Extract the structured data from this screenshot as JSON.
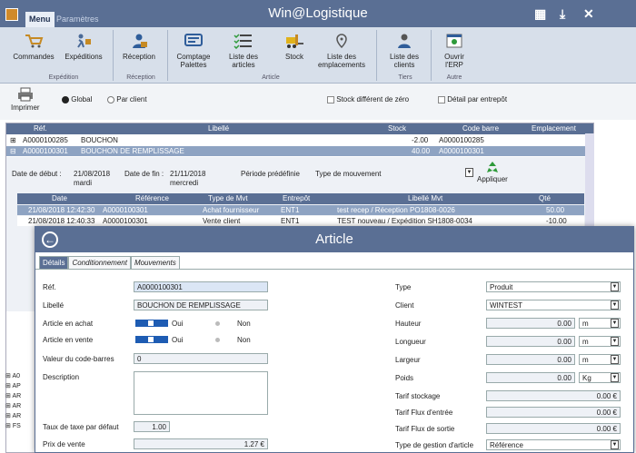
{
  "titlebar": {
    "title": "Win@Logistique",
    "menu_tab": "Menu",
    "param_tab": "Paramètres"
  },
  "ribbon": {
    "commandes": "Commandes",
    "expeditions": "Expéditions",
    "reception": "Réception",
    "comptage_l1": "Comptage",
    "comptage_l2": "Palettes",
    "liste_articles_l1": "Liste des",
    "liste_articles_l2": "articles",
    "stock": "Stock",
    "liste_emplacements_l1": "Liste des",
    "liste_emplacements_l2": "emplacements",
    "liste_clients_l1": "Liste des",
    "liste_clients_l2": "clients",
    "ouvrir_l1": "Ouvrir",
    "ouvrir_l2": "l'ERP",
    "group_expedition": "Expédition",
    "group_reception": "Réception",
    "group_article": "Article",
    "group_tiers": "Tiers",
    "group_autre": "Autre"
  },
  "toolbar": {
    "imprimer": "Imprimer",
    "global": "Global",
    "par_client": "Par client",
    "stock_diff": "Stock différent de zéro",
    "detail": "Détail par entrepôt"
  },
  "grid": {
    "headers": {
      "ref": "Réf.",
      "libelle": "Libellé",
      "stock": "Stock",
      "code_barre": "Code barre",
      "emplacement": "Emplacement"
    },
    "rows": [
      {
        "ref": "A0000100285",
        "libelle": "BOUCHON",
        "stock": "-2.00",
        "code": "A0000100285"
      },
      {
        "ref": "A0000100301",
        "libelle": "BOUCHON DE REMPLISSAGE",
        "stock": "40.00",
        "code": "A0000100301"
      }
    ],
    "date_debut_label": "Date de début :",
    "date_debut": "21/08/2018",
    "date_debut_day": "mardi",
    "date_fin_label": "Date de fin :",
    "date_fin": "21/11/2018",
    "date_fin_day": "mercredi",
    "periode": "Période prédéfinie",
    "type_mvt": "Type de mouvement",
    "appliquer": "Appliquer",
    "sub_headers": {
      "date": "Date",
      "ref": "Référence",
      "type": "Type de Mvt",
      "entrepot": "Entrepôt",
      "libelle": "Libellé Mvt",
      "qte": "Qté"
    },
    "sub_rows": [
      {
        "date": "21/08/2018 12:42:30",
        "ref": "A0000100301",
        "type": "Achat fournisseur",
        "entrepot": "ENT1",
        "libelle": "test recep / Réception  PO1808-0026",
        "qte": "50.00"
      },
      {
        "date": "21/08/2018 12:40:33",
        "ref": "A0000100301",
        "type": "Vente client",
        "entrepot": "ENT1",
        "libelle": "TEST nouveau / Expédition  SH1808-0034",
        "qte": "-10.00"
      }
    ],
    "collapsed": [
      "A0",
      "AP",
      "AR",
      "AR",
      "AR",
      "FS"
    ]
  },
  "dialog": {
    "title": "Article",
    "tabs": [
      "Détails",
      "Conditionnement",
      "Mouvements"
    ],
    "ref_label": "Réf.",
    "ref": "A0000100301",
    "libelle_label": "Libellé",
    "libelle": "BOUCHON DE REMPLISSAGE",
    "achat_label": "Article en achat",
    "vente_label": "Article en vente",
    "oui": "Oui",
    "non": "Non",
    "codebarre_label": "Valeur du code-barres",
    "codebarre": "0",
    "description_label": "Description",
    "taxe_label": "Taux de taxe par défaut",
    "taxe": "1.00",
    "prix_label": "Prix de vente",
    "prix": "1.27 €",
    "type_label": "Type",
    "type": "Produit",
    "client_label": "Client",
    "client": "WINTEST",
    "hauteur_label": "Hauteur",
    "hauteur": "0.00",
    "hauteur_unit": "m",
    "longueur_label": "Longueur",
    "longueur": "0.00",
    "longueur_unit": "m",
    "largeur_label": "Largeur",
    "largeur": "0.00",
    "largeur_unit": "m",
    "poids_label": "Poids",
    "poids": "0.00",
    "poids_unit": "Kg",
    "tarif_stock_label": "Tarif stockage",
    "tarif_stock": "0.00 €",
    "tarif_entree_label": "Tarif Flux d'entrée",
    "tarif_entree": "0.00 €",
    "tarif_sortie_label": "Tarif Flux de sortie",
    "tarif_sortie": "0.00 €",
    "gestion_label": "Type de gestion d'article",
    "gestion": "Référence"
  }
}
